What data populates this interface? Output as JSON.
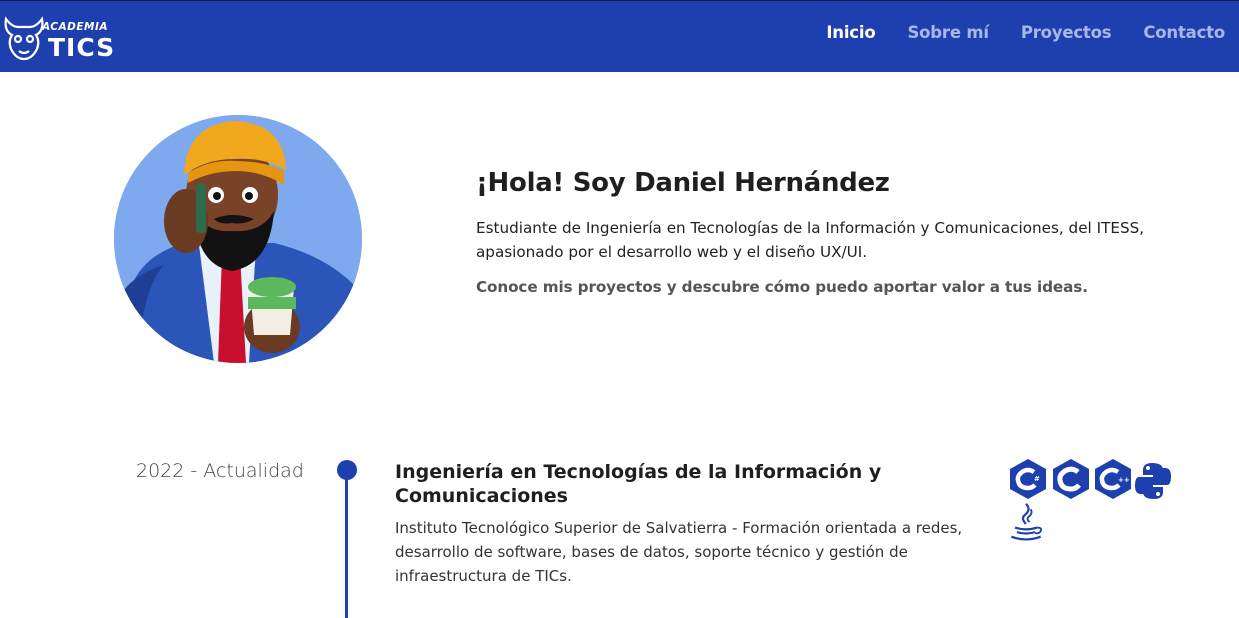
{
  "brand": {
    "logo_top": "ACADEMIA",
    "logo_bottom": "TICS",
    "color": "#1e40af"
  },
  "nav": {
    "items": [
      {
        "label": "Inicio",
        "active": true
      },
      {
        "label": "Sobre mí",
        "active": false
      },
      {
        "label": "Proyectos",
        "active": false
      },
      {
        "label": "Contacto",
        "active": false
      }
    ]
  },
  "hero": {
    "title": "¡Hola! Soy Daniel Hernández",
    "description": "Estudiante de Ingeniería en Tecnologías de la Información y Comunicaciones, del ITESS, apasionado por el desarrollo web y el diseño UX/UI.",
    "cta": "Conoce mis proyectos y descubre cómo puedo aportar valor a tus ideas."
  },
  "timeline": {
    "items": [
      {
        "date": "2022 - Actualidad",
        "title": "Ingeniería en Tecnologías de la Información y Comunicaciones",
        "description": "Instituto Tecnológico Superior de Salvatierra - Formación orientada a redes, desarrollo de software, bases de datos, soporte técnico y gestión de infraestructura de TICs.",
        "tech_icons": [
          "csharp-icon",
          "c-icon",
          "cplusplus-icon",
          "python-icon",
          "java-icon"
        ]
      }
    ]
  }
}
